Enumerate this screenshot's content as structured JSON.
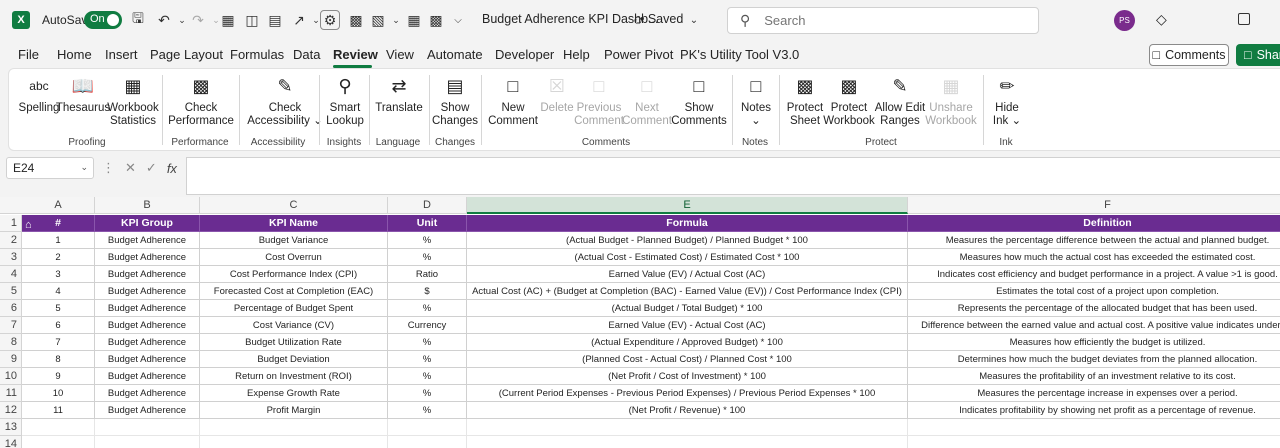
{
  "titlebar": {
    "app_logo": "X",
    "autosave_label": "AutoSave",
    "autosave_state": "On",
    "doc_title": "Budget Adherence KPI Dashb...",
    "saved_status": "• Saved",
    "search_placeholder": "Search",
    "avatar_initials": "PS"
  },
  "menu": {
    "tabs": [
      "File",
      "Home",
      "Insert",
      "Page Layout",
      "Formulas",
      "Data",
      "Review",
      "View",
      "Automate",
      "Developer",
      "Help",
      "Power Pivot",
      "PK's Utility Tool V3.0"
    ],
    "active_tab": "Review",
    "comments_label": "Comments",
    "share_label": "Share"
  },
  "ribbon": {
    "buttons": [
      {
        "line1": "Spelling",
        "line2": "",
        "icon": "spelling-icon",
        "disabled": false
      },
      {
        "line1": "Thesaurus",
        "line2": "",
        "icon": "thesaurus-icon",
        "disabled": false
      },
      {
        "line1": "Workbook",
        "line2": "Statistics",
        "icon": "workbook-statistics-icon",
        "disabled": false
      },
      {
        "line1": "Check",
        "line2": "Performance",
        "icon": "check-performance-icon",
        "disabled": false
      },
      {
        "line1": "Check",
        "line2": "Accessibility ⌄",
        "icon": "check-accessibility-icon",
        "disabled": false
      },
      {
        "line1": "Smart",
        "line2": "Lookup",
        "icon": "smart-lookup-icon",
        "disabled": false
      },
      {
        "line1": "Translate",
        "line2": "",
        "icon": "translate-icon",
        "disabled": false
      },
      {
        "line1": "Show",
        "line2": "Changes",
        "icon": "show-changes-icon",
        "disabled": false
      },
      {
        "line1": "New",
        "line2": "Comment",
        "icon": "new-comment-icon",
        "disabled": false
      },
      {
        "line1": "Delete",
        "line2": "",
        "icon": "delete-comment-icon",
        "disabled": true
      },
      {
        "line1": "Previous",
        "line2": "Comment",
        "icon": "previous-comment-icon",
        "disabled": true
      },
      {
        "line1": "Next",
        "line2": "Comment",
        "icon": "next-comment-icon",
        "disabled": true
      },
      {
        "line1": "Show",
        "line2": "Comments",
        "icon": "show-comments-icon",
        "disabled": false
      },
      {
        "line1": "Notes",
        "line2": "⌄",
        "icon": "notes-icon",
        "disabled": false
      },
      {
        "line1": "Protect",
        "line2": "Sheet",
        "icon": "protect-sheet-icon",
        "disabled": false
      },
      {
        "line1": "Protect",
        "line2": "Workbook",
        "icon": "protect-workbook-icon",
        "disabled": false
      },
      {
        "line1": "Allow Edit",
        "line2": "Ranges",
        "icon": "allow-edit-ranges-icon",
        "disabled": false
      },
      {
        "line1": "Unshare",
        "line2": "Workbook",
        "icon": "unshare-workbook-icon",
        "disabled": true
      },
      {
        "line1": "Hide",
        "line2": "Ink ⌄",
        "icon": "hide-ink-icon",
        "disabled": false
      }
    ],
    "groups": [
      "Proofing",
      "Performance",
      "Accessibility",
      "Insights",
      "Language",
      "Changes",
      "Comments",
      "Notes",
      "Protect",
      "Ink"
    ]
  },
  "formula_bar": {
    "name_box": "E24",
    "fx_label": "fx",
    "formula": ""
  },
  "sheet": {
    "columns": [
      "A",
      "B",
      "C",
      "D",
      "E",
      "F"
    ],
    "selected_column": "E",
    "row_numbers": [
      "1",
      "2",
      "3",
      "4",
      "5",
      "6",
      "7",
      "8",
      "9",
      "10",
      "11",
      "12",
      "13",
      "14"
    ],
    "headers": [
      "#",
      "KPI Group",
      "KPI Name",
      "Unit",
      "Formula",
      "Definition"
    ],
    "rows": [
      [
        "1",
        "Budget Adherence",
        "Budget Variance",
        "%",
        "(Actual Budget - Planned Budget) / Planned Budget * 100",
        "Measures the percentage difference between the actual and planned budget."
      ],
      [
        "2",
        "Budget Adherence",
        "Cost Overrun",
        "%",
        "(Actual Cost - Estimated Cost) / Estimated Cost * 100",
        "Measures how much the actual cost has exceeded the estimated cost."
      ],
      [
        "3",
        "Budget Adherence",
        "Cost Performance Index (CPI)",
        "Ratio",
        "Earned Value (EV) / Actual Cost (AC)",
        "Indicates cost efficiency and budget performance in a project. A value >1 is good."
      ],
      [
        "4",
        "Budget Adherence",
        "Forecasted Cost at Completion (EAC)",
        "$",
        "Actual Cost (AC) + (Budget at Completion (BAC) - Earned Value (EV)) / Cost Performance Index (CPI)",
        "Estimates the total cost of a project upon completion."
      ],
      [
        "5",
        "Budget Adherence",
        "Percentage of Budget Spent",
        "%",
        "(Actual Budget / Total Budget) * 100",
        "Represents the percentage of the allocated budget that has been used."
      ],
      [
        "6",
        "Budget Adherence",
        "Cost Variance (CV)",
        "Currency",
        "Earned Value (EV) - Actual Cost (AC)",
        "Difference between the earned value and actual cost. A positive value indicates under bu"
      ],
      [
        "7",
        "Budget Adherence",
        "Budget Utilization Rate",
        "%",
        "(Actual Expenditure / Approved Budget) * 100",
        "Measures how efficiently the budget is utilized."
      ],
      [
        "8",
        "Budget Adherence",
        "Budget Deviation",
        "%",
        "(Planned Cost - Actual Cost) / Planned Cost * 100",
        "Determines how much the budget deviates from the planned allocation."
      ],
      [
        "9",
        "Budget Adherence",
        "Return on Investment (ROI)",
        "%",
        "(Net Profit / Cost of Investment) * 100",
        "Measures the profitability of an investment relative to its cost."
      ],
      [
        "10",
        "Budget Adherence",
        "Expense Growth Rate",
        "%",
        "(Current Period Expenses - Previous Period Expenses) / Previous Period Expenses * 100",
        "Measures the percentage increase in expenses over a period."
      ],
      [
        "11",
        "Budget Adherence",
        "Profit Margin",
        "%",
        "(Net Profit / Revenue) * 100",
        "Indicates profitability by showing net profit as a percentage of revenue."
      ]
    ]
  }
}
